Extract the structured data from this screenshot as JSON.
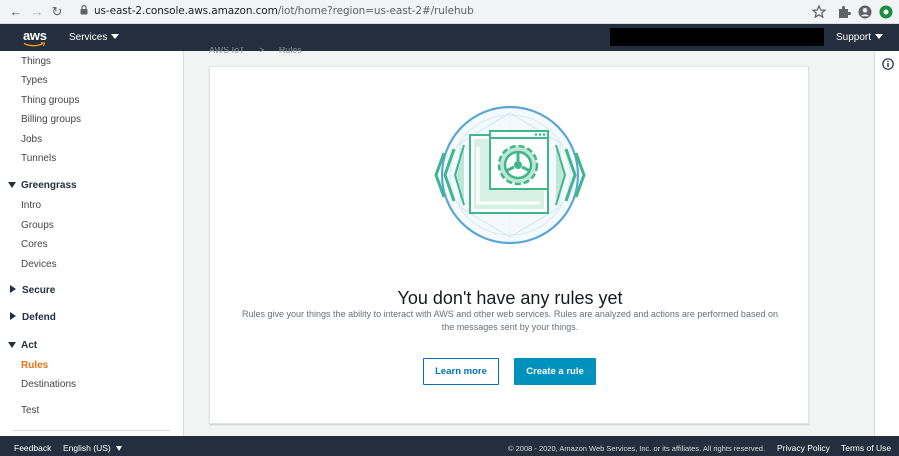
{
  "browser": {
    "url_host": "us-east-2.console.aws.amazon.com",
    "url_path": "/iot/home?region=us-east-2#/rulehub"
  },
  "header": {
    "logo": "aws",
    "services_label": "Services",
    "support_label": "Support"
  },
  "sidebar": {
    "items_top": [
      "Things",
      "Types",
      "Thing groups",
      "Billing groups",
      "Jobs",
      "Tunnels"
    ],
    "greengrass": {
      "label": "Greengrass",
      "items": [
        "Intro",
        "Groups",
        "Cores",
        "Devices"
      ]
    },
    "secure_label": "Secure",
    "defend_label": "Defend",
    "act": {
      "label": "Act",
      "items": [
        "Rules",
        "Destinations"
      ]
    },
    "test_label": "Test"
  },
  "breadcrumb": {
    "root": "AWS IoT",
    "sep": ">",
    "current": "Rules"
  },
  "empty_state": {
    "title": "You don't have any rules yet",
    "description": "Rules give your things the ability to interact with AWS and other web services. Rules are analyzed and actions are performed based on the messages sent by your things.",
    "learn_more_label": "Learn more",
    "create_label": "Create a rule"
  },
  "footer": {
    "feedback": "Feedback",
    "language": "English (US)",
    "copyright": "© 2008 - 2020, Amazon Web Services, Inc. or its affiliates. All rights reserved.",
    "privacy": "Privacy Policy",
    "terms": "Terms of Use"
  },
  "colors": {
    "header_bg": "#232f3e",
    "accent_orange": "#ec7211",
    "primary_button": "#0091bd",
    "link_blue": "#0073bb",
    "illustration_green": "#3fb68b"
  }
}
